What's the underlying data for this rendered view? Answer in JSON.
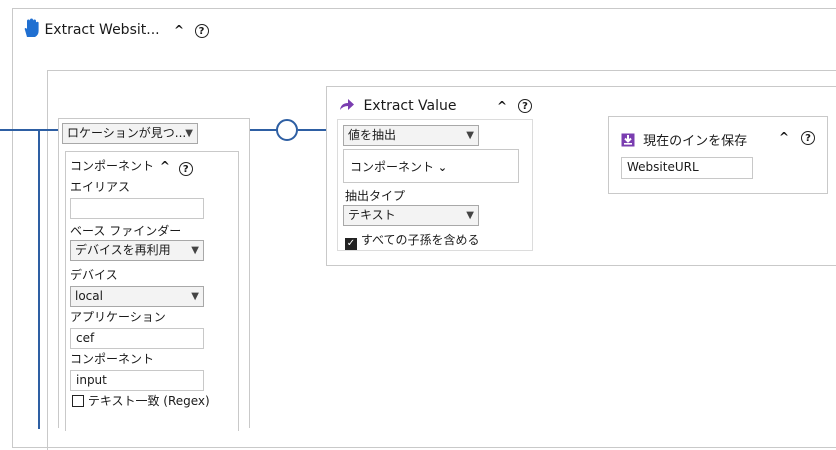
{
  "colors": {
    "blue": "#2e5fa3",
    "purple": "#8b4bbb",
    "panel_border": "#c9c9c9"
  },
  "header": {
    "icon": "hand-icon",
    "title": "Extract Websit..."
  },
  "location": {
    "selector_value": "ロケーションが見つ...",
    "component_header": "コンポーネント",
    "alias_label": "エイリアス",
    "alias_value": "",
    "base_finder_label": "ベース ファインダー",
    "base_finder_value": "デバイスを再利用",
    "device_label": "デバイス",
    "device_value": "local",
    "application_label": "アプリケーション",
    "application_value": "cef",
    "component_label": "コンポーネント",
    "component_value": "input",
    "regex_label": "テキスト一致 (Regex)",
    "regex_checked": false
  },
  "extract": {
    "icon": "share-arrow-icon",
    "title": "Extract Value",
    "action_value": "値を抽出",
    "component_dropdown": "コンポーネント",
    "type_label": "抽出タイプ",
    "type_value": "テキスト",
    "include_children_label": "すべての子孫を含める",
    "include_children_checked": true
  },
  "save": {
    "icon": "save-download-icon",
    "title": "現在のインを保存",
    "value": "WebsiteURL"
  }
}
